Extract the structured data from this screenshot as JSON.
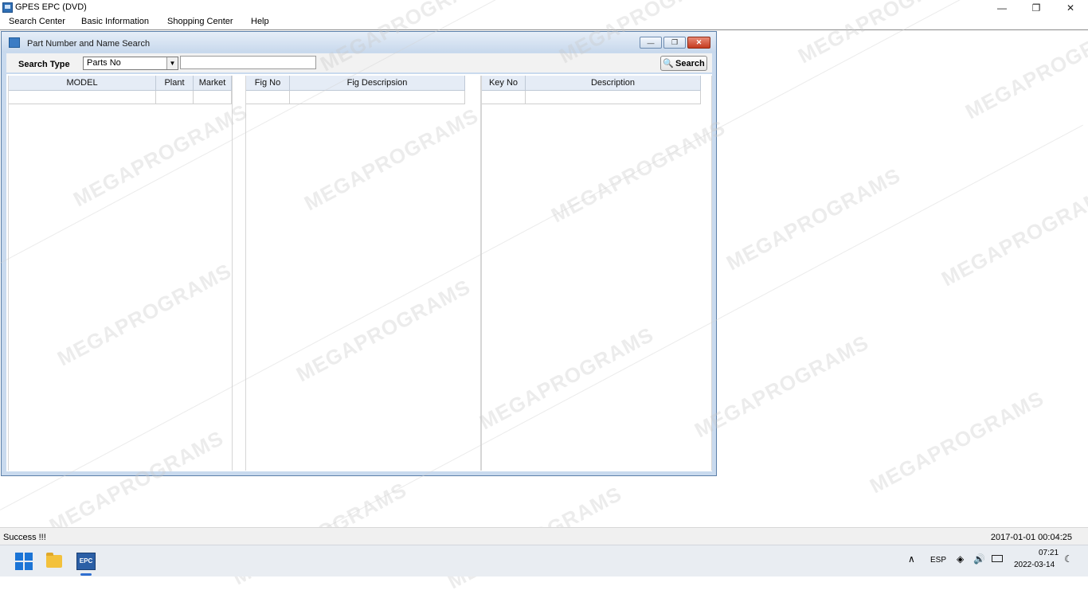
{
  "app": {
    "title": "GPES EPC (DVD)",
    "minimize_glyph": "—",
    "maximize_glyph": "❐",
    "close_glyph": "✕"
  },
  "menu": [
    "Search Center",
    "Basic Information",
    "Shopping Center",
    "Help"
  ],
  "search_window": {
    "title": "Part Number and Name Search",
    "search_type_label": "Search Type",
    "search_type_value": "Parts No",
    "search_input_value": "",
    "search_button_label": "Search",
    "grids": {
      "model": [
        "MODEL",
        "Plant",
        "Market"
      ],
      "fig": [
        "Fig No",
        "Fig Descripsion"
      ],
      "key": [
        "Key No",
        "Description"
      ]
    }
  },
  "status": {
    "message": "Success !!!",
    "datetime": "2017-01-01 00:04:25"
  },
  "taskbar": {
    "epc_label": "EPC",
    "language": "ESP",
    "time": "07:21",
    "date": "2022-03-14"
  },
  "watermark": "MEGAPROGRAMS"
}
